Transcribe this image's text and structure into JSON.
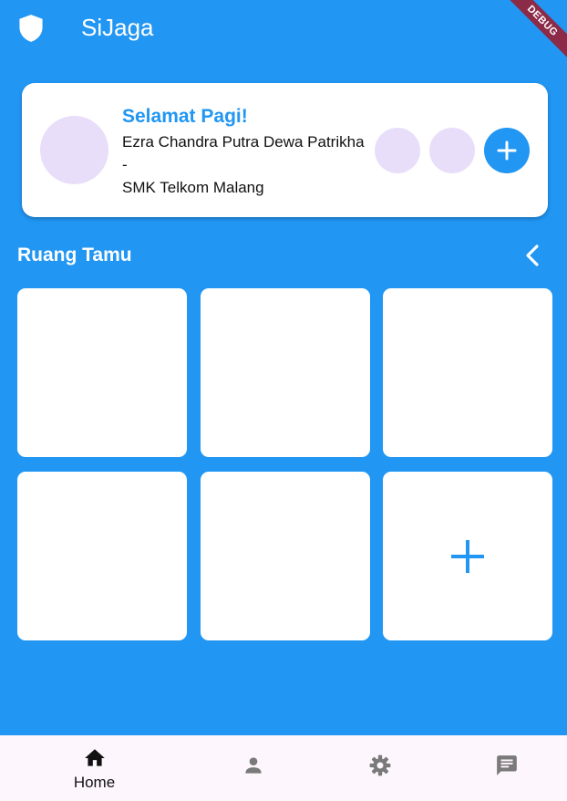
{
  "app": {
    "title": "SiJaga",
    "icon": "shield-icon",
    "debug_label": "DEBUG"
  },
  "colors": {
    "primary": "#2196F3",
    "surface": "#FFFFFF",
    "avatar_placeholder": "#E8DEFA",
    "nav_background": "#FDF6FC",
    "nav_inactive": "#7A7A7A",
    "debug_ribbon": "#8B2B48"
  },
  "profile_card": {
    "greeting": "Selamat Pagi!",
    "name": "Ezra Chandra Putra Dewa Patrikha",
    "separator": "-",
    "school": "SMK Telkom Malang",
    "avatar_icon": "avatar",
    "member_avatars": [
      "avatar",
      "avatar"
    ],
    "add_button_icon": "plus-icon"
  },
  "section": {
    "title": "Ruang Tamu",
    "collapse_icon": "chevron-left-icon"
  },
  "tiles": [
    {
      "type": "empty"
    },
    {
      "type": "empty"
    },
    {
      "type": "empty"
    },
    {
      "type": "empty"
    },
    {
      "type": "empty"
    },
    {
      "type": "add",
      "icon": "plus-icon"
    }
  ],
  "bottom_nav": {
    "items": [
      {
        "label": "Home",
        "icon": "home-icon",
        "active": true
      },
      {
        "label": "",
        "icon": "person-icon",
        "active": false
      },
      {
        "label": "",
        "icon": "settings-icon",
        "active": false
      },
      {
        "label": "",
        "icon": "chat-icon",
        "active": false
      }
    ]
  }
}
